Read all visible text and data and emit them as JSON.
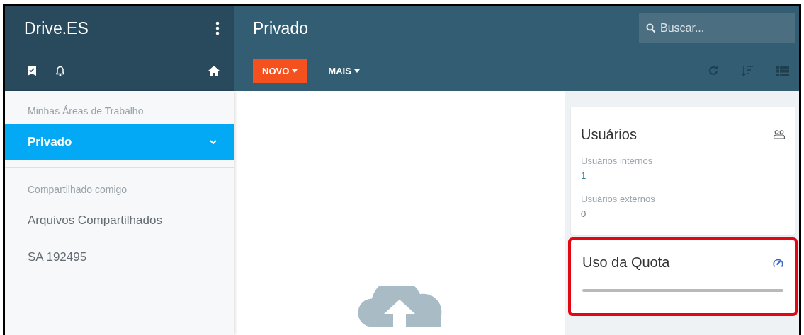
{
  "app": {
    "name": "Drive.ES"
  },
  "page": {
    "title": "Privado"
  },
  "search": {
    "placeholder": "Buscar..."
  },
  "toolbar": {
    "buttons": [
      {
        "label": "NOVO",
        "kind": "primary"
      },
      {
        "label": "MAIS",
        "kind": "flat"
      }
    ]
  },
  "sidebar": {
    "sections": [
      {
        "heading": "Minhas Áreas de Trabalho",
        "items": [
          {
            "label": "Privado",
            "selected": true,
            "expanded": true
          }
        ]
      },
      {
        "heading": "Compartilhado comigo",
        "items": [
          {
            "label": "Arquivos Compartilhados",
            "selected": false
          },
          {
            "label": "SA 192495",
            "selected": false
          }
        ]
      }
    ]
  },
  "cards": [
    {
      "kind": "users",
      "title": "Usuários",
      "stats": [
        {
          "label": "Usuários internos",
          "value": "1"
        },
        {
          "label": "Usuários externos",
          "value": "0"
        }
      ]
    },
    {
      "kind": "quota",
      "title": "Uso da Quota",
      "level": 0,
      "highlighted": true
    }
  ]
}
